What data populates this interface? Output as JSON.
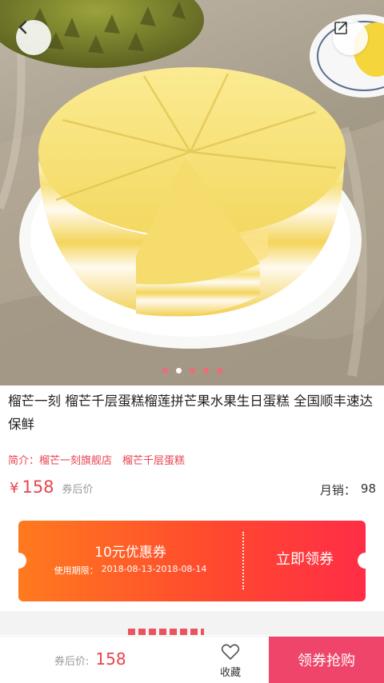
{
  "product": {
    "title": "榴芒一刻 榴芒千层蛋糕榴莲拼芒果水果生日蛋糕 全国顺丰速达保鲜",
    "intro_label": "简介：",
    "shop_name": "榴芒一刻旗舰店",
    "category": "榴芒千层蛋糕",
    "currency": "¥",
    "price": "158",
    "price_note": "券后价",
    "sales_label": "月销：",
    "sales_count": "98"
  },
  "carousel": {
    "total": 5,
    "active_index": 1
  },
  "coupon": {
    "amount_text": "10元优惠券",
    "period_label": "使用期限：",
    "period_value": "2018-08-13-2018-08-14",
    "action_label": "立即领券"
  },
  "bottom_bar": {
    "price_label": "券后价:",
    "price_value": "158",
    "favorite_label": "收藏",
    "buy_label": "领券抢购"
  },
  "icons": {
    "back": "chevron-left-icon",
    "share": "share-icon",
    "favorite": "heart-outline-icon"
  },
  "colors": {
    "accent": "#e8434e",
    "coupon_start": "#ff7a1e",
    "coupon_end": "#ff2d46",
    "buy_button": "#f0456a"
  }
}
